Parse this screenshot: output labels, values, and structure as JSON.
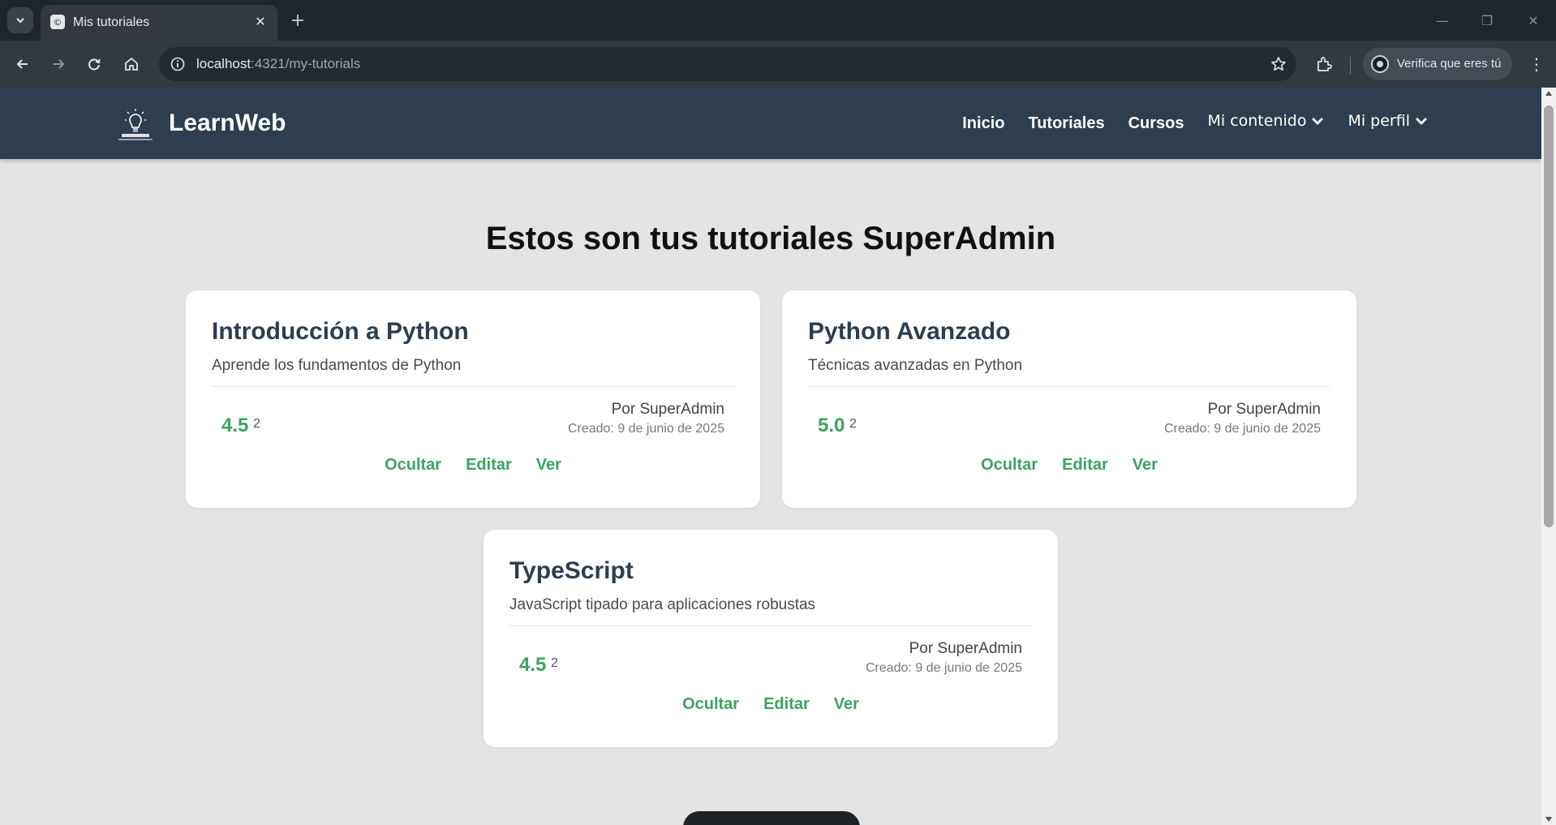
{
  "browser": {
    "tab_title": "Mis tutoriales",
    "url_host": "localhost",
    "url_path": ":4321/my-tutorials",
    "profile_label": "Verifica que eres tú"
  },
  "site": {
    "brand": "LearnWeb",
    "nav": {
      "home": "Inicio",
      "tutorials": "Tutoriales",
      "courses": "Cursos",
      "my_content": "Mi contenido",
      "my_profile": "Mi perfil"
    }
  },
  "page": {
    "title": "Estos son tus tutoriales SuperAdmin",
    "actions": {
      "hide": "Ocultar",
      "edit": "Editar",
      "view": "Ver"
    }
  },
  "tutorials": [
    {
      "title": "Introducción a Python",
      "description": "Aprende los fundamentos de Python",
      "rating": "4.5",
      "rating_count": "2",
      "author": "Por SuperAdmin",
      "created": "Creado: 9 de junio de 2025"
    },
    {
      "title": "Python Avanzado",
      "description": "Técnicas avanzadas en Python",
      "rating": "5.0",
      "rating_count": "2",
      "author": "Por SuperAdmin",
      "created": "Creado: 9 de junio de 2025"
    },
    {
      "title": "TypeScript",
      "description": "JavaScript tipado para aplicaciones robustas",
      "rating": "4.5",
      "rating_count": "2",
      "author": "Por SuperAdmin",
      "created": "Creado: 9 de junio de 2025"
    }
  ],
  "colors": {
    "nav_bg": "#2c3e50",
    "accent": "#3ba55c",
    "page_bg": "#e4e4e4"
  }
}
